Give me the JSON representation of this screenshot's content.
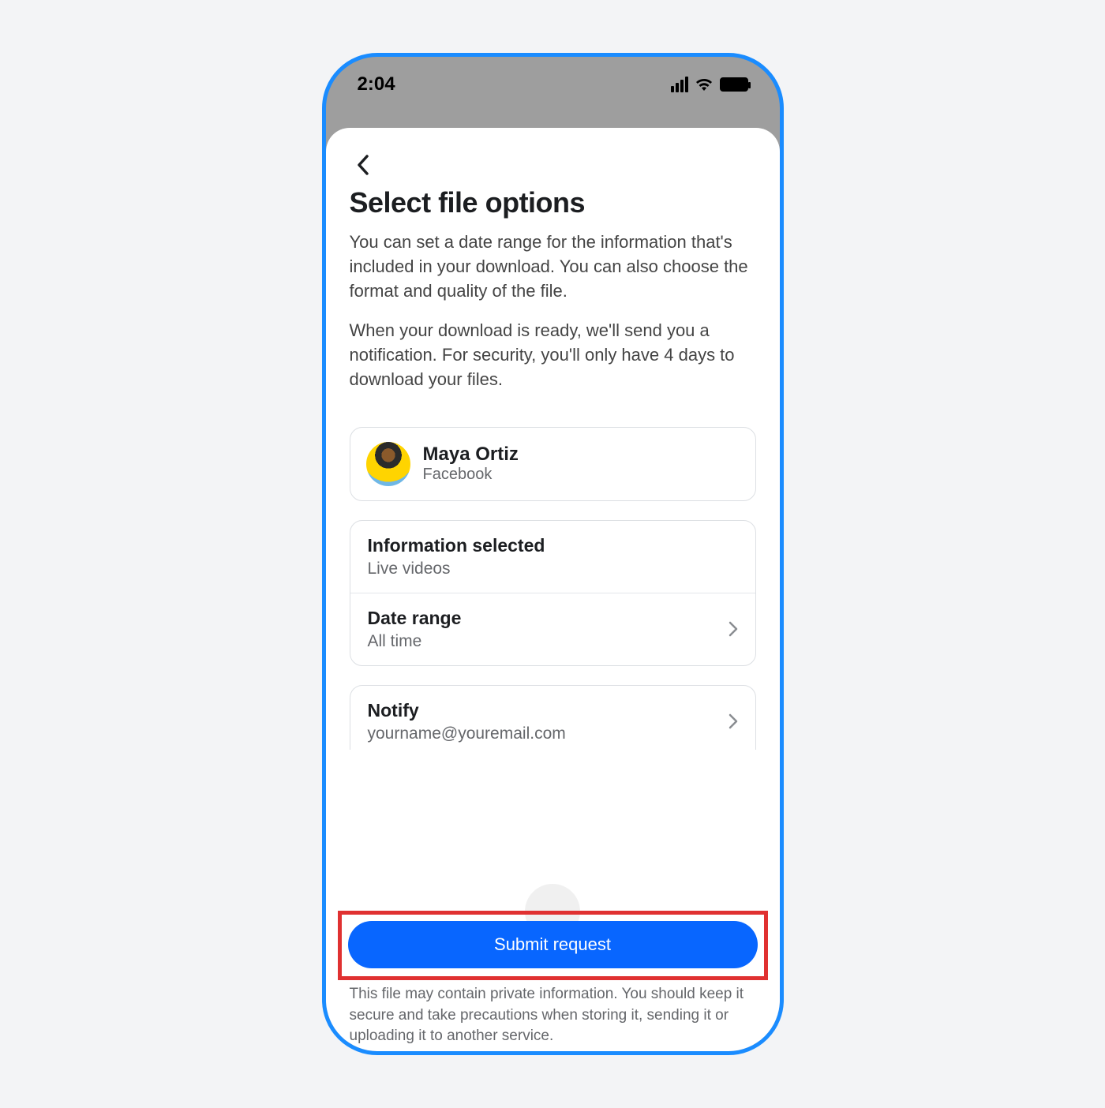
{
  "status": {
    "time": "2:04"
  },
  "header": {
    "title": "Select file options",
    "desc1": "You can set a date range for the information that's included in your download. You can also choose the format and quality of the file.",
    "desc2": "When your download is ready, we'll send you a notification. For security, you'll only have 4 days to download your files."
  },
  "account": {
    "name": "Maya Ortiz",
    "platform": "Facebook"
  },
  "options": {
    "info_label": "Information selected",
    "info_value": "Live videos",
    "range_label": "Date range",
    "range_value": "All time",
    "notify_label": "Notify",
    "notify_value": "yourname@youremail.com"
  },
  "submit_label": "Submit request",
  "footer": "This file may contain private information. You should keep it secure and take precautions when storing it, sending it or uploading it to another service."
}
